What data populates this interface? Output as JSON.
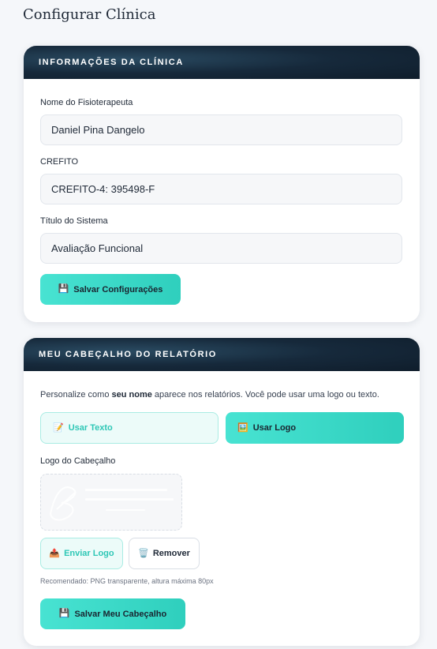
{
  "page": {
    "title": "Configurar Clínica"
  },
  "clinic_card": {
    "header": "INFORMAÇÕES DA CLÍNICA",
    "fields": [
      {
        "label": "Nome do Fisioterapeuta",
        "value": "Daniel Pina Dangelo"
      },
      {
        "label": "CREFITO",
        "value": "CREFITO-4: 395498-F"
      },
      {
        "label": "Título do Sistema",
        "value": "Avaliação Funcional"
      }
    ],
    "save_label": "Salvar Configurações",
    "save_icon": "floppy-disk-icon"
  },
  "header_card": {
    "header": "MEU CABEÇALHO DO RELATÓRIO",
    "intro_before": "Personalize como ",
    "intro_bold": "seu nome",
    "intro_after": " aparece nos relatórios. Você pode usar uma logo ou texto.",
    "toggle_text_label": "Usar Texto",
    "toggle_text_icon": "memo-icon",
    "toggle_logo_label": "Usar Logo",
    "toggle_logo_icon": "picture-icon",
    "logo_label": "Logo do Cabeçalho",
    "upload_label": "Enviar Logo",
    "upload_icon": "upload-tray-icon",
    "remove_label": "Remover",
    "remove_icon": "trash-icon",
    "hint": "Recomendado: PNG transparente, altura máxima 80px",
    "save_label": "Salvar Meu Cabeçalho",
    "save_icon": "floppy-disk-icon"
  },
  "colors": {
    "accent": "#3fdccb",
    "header_dark": "#16293b",
    "background": "#f5f7fa"
  }
}
